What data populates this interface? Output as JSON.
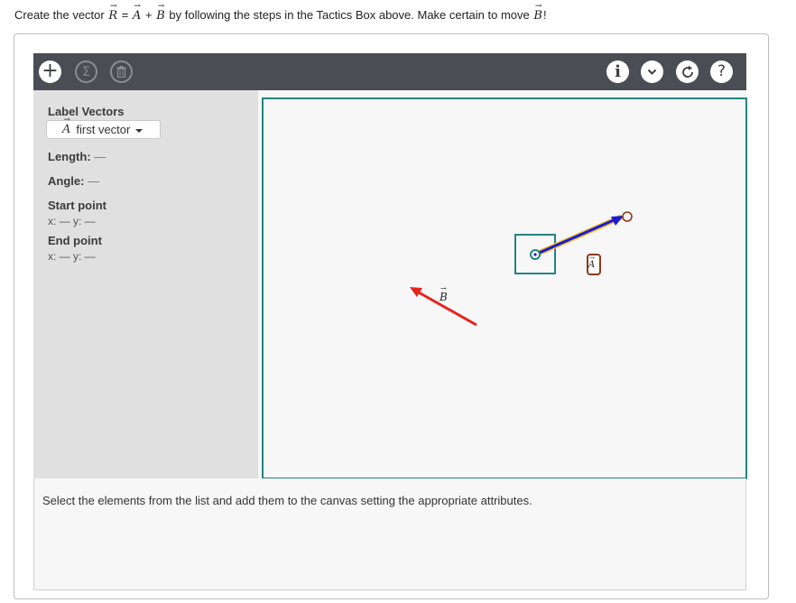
{
  "prompt": {
    "before": "Create the vector",
    "R": "R",
    "equals": "=",
    "A": "A",
    "plus": "+",
    "B": "B",
    "after": "by following the steps in the Tactics Box above. Make certain to move",
    "end_vector": "B",
    "end_punct": "!",
    "arrow_glyph": "→"
  },
  "toolbar": {
    "icons": [
      "plus-icon",
      "sigma-icon",
      "trash-icon",
      "info-icon",
      "chevron-down-icon",
      "reset-icon",
      "help-icon"
    ],
    "plus": "+",
    "sigma": "Σ",
    "info": "i",
    "chevron": "⌄",
    "reset": "↻",
    "help": "?"
  },
  "panel": {
    "label_vectors": "Label Vectors",
    "dropdown": {
      "vector": "A",
      "text": "first vector"
    },
    "length": "Length:",
    "length_value": "—",
    "angle": "Angle:",
    "angle_value": "—",
    "start_point": "Start point",
    "start_coords": "x: — y: —",
    "end_point": "End point",
    "end_coords": "x: — y: —"
  },
  "canvas": {
    "label_B": "B",
    "label_A": "A",
    "colors": {
      "vector_A": "#1a1ad6",
      "vector_A_highlight": "#f0c030",
      "vector_B": "#e8231e",
      "selection": "#23847e",
      "handle_end": "#8b3a1f"
    }
  },
  "footer": {
    "text": "Select the elements from the list and add them to the canvas setting the appropriate attributes."
  }
}
